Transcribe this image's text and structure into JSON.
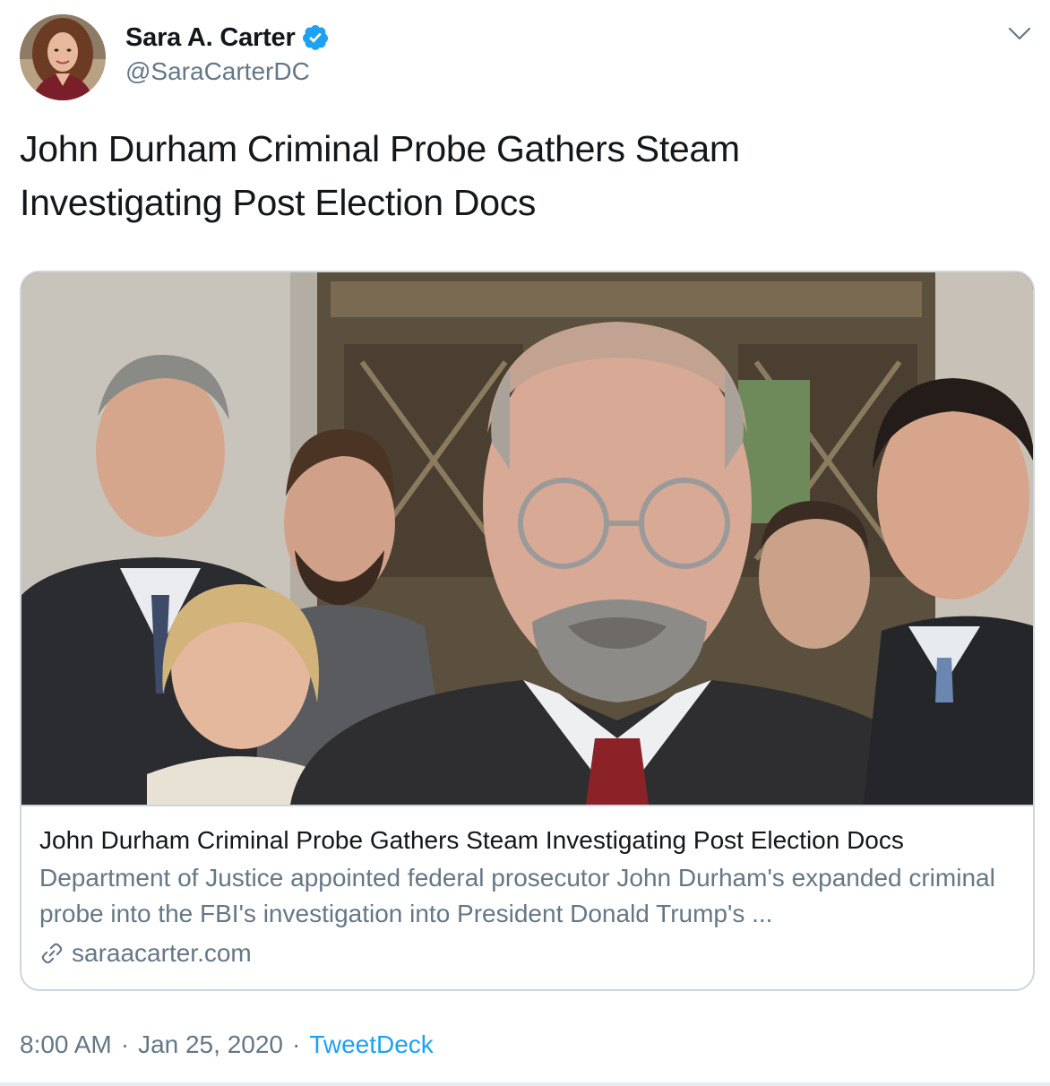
{
  "tweet": {
    "author": {
      "display_name": "Sara A. Carter",
      "handle": "@SaraCarterDC",
      "verified": true
    },
    "text_line_1": "John Durham Criminal Probe Gathers Steam",
    "text_line_2": "Investigating Post Election Docs",
    "card": {
      "title": "John Durham Criminal Probe Gathers Steam Investigating Post Election Docs",
      "description": "Department of Justice appointed federal prosecutor John Durham's expanded criminal probe into the FBI's investigation into President Donald Trump's ...",
      "domain": "saraacarter.com"
    },
    "meta": {
      "time": "8:00 AM",
      "separator": "·",
      "date": "Jan 25, 2020",
      "source": "TweetDeck"
    }
  },
  "icons": [
    "verified-badge-icon",
    "chevron-down-icon",
    "link-icon"
  ],
  "colors": {
    "text_primary": "#14171a",
    "text_secondary": "#657786",
    "accent": "#1da1f2",
    "border": "#ccd6dd"
  }
}
